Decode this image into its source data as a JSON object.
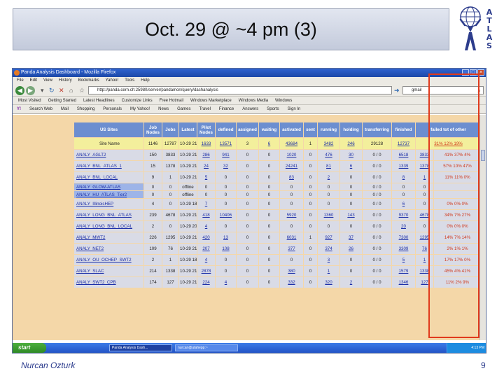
{
  "slide": {
    "title": "Oct. 29 @ ~4 pm (3)",
    "author": "Nurcan Ozturk",
    "page_number": "9",
    "logo_letters": [
      "A",
      "T",
      "L",
      "A",
      "S"
    ]
  },
  "browser": {
    "window_title": "Panda Analysis Dashboard - Mozilla Firefox",
    "menu": [
      "File",
      "Edit",
      "View",
      "History",
      "Bookmarks",
      "Yahoo!",
      "Tools",
      "Help"
    ],
    "url": "http://panda.cern.ch:25980/server/pandamon/query/dashanalysis",
    "search_value": "gmail",
    "bookmarks": [
      "Most Visited",
      "Getting Started",
      "Latest Headlines",
      "Customize Links",
      "Free Hotmail",
      "Windows Marketplace",
      "Windows Media",
      "Windows"
    ],
    "yahoo_toolbar": [
      "Search Web",
      "Mail",
      "Shopping",
      "Personals",
      "My Yahoo!",
      "News",
      "Games",
      "Travel",
      "Finance",
      "Answers",
      "Sports",
      "Sign In"
    ]
  },
  "table": {
    "headers": [
      "US Sites",
      "Job Nodes",
      "Jobs",
      "Latest",
      "Pilot Nodes",
      "defined",
      "assigned",
      "waiting",
      "activated",
      "sent",
      "running",
      "holding",
      "transferring",
      "finished",
      "failed tot of other"
    ],
    "summary": [
      "Site Name",
      "1146",
      "12787",
      "10-29 21:08",
      "1633",
      "13571",
      "3",
      "6",
      "43684",
      "1",
      "3482",
      "246",
      "29128",
      "12737",
      "31% 12% 19%"
    ],
    "rows": [
      [
        "ANALY_AGLT2",
        "150",
        "3833",
        "10-29 21:08",
        "286",
        "941",
        "0",
        "0",
        "1020",
        "0",
        "476",
        "30",
        "0 / 0",
        "6518",
        "3833",
        "41% 37% 4%"
      ],
      [
        "ANALY_BNL_ATLAS_1",
        "15",
        "1378",
        "10-29 21:08",
        "24",
        "32",
        "0",
        "0",
        "24241",
        "0",
        "81",
        "6",
        "0 / 0",
        "1339",
        "1378",
        "57% 10% 47%"
      ],
      [
        "ANALY_BNL_LOCAL",
        "9",
        "1",
        "10-29 21:07",
        "5",
        "0",
        "0",
        "0",
        "83",
        "0",
        "2",
        "0",
        "0 / 0",
        "8",
        "1",
        "11% 11% 0%"
      ],
      [
        "ANALY_GLOW-ATLAS",
        "0",
        "0",
        "offline",
        "0",
        "0",
        "0",
        "0",
        "0",
        "0",
        "0",
        "0",
        "0 / 0",
        "0",
        "0",
        ""
      ],
      [
        "ANALY_HU_ATLAS_Tier2",
        "0",
        "0",
        "offline",
        "0",
        "0",
        "0",
        "0",
        "0",
        "0",
        "0",
        "0",
        "0 / 0",
        "0",
        "0",
        ""
      ],
      [
        "ANALY_IllinoisHEP",
        "4",
        "0",
        "10-29 18:45",
        "7",
        "0",
        "0",
        "0",
        "0",
        "0",
        "0",
        "0",
        "0 / 0",
        "6",
        "0",
        "0% 0% 0%"
      ],
      [
        "ANALY_LONG_BNL_ATLAS",
        "239",
        "4678",
        "10-29 21:08",
        "418",
        "10406",
        "0",
        "0",
        "5920",
        "0",
        "1360",
        "143",
        "0 / 0",
        "9370",
        "4678",
        "34% 7% 27%"
      ],
      [
        "ANALY_LONG_BNL_LOCAL",
        "2",
        "0",
        "10-29 20:49",
        "4",
        "0",
        "0",
        "0",
        "0",
        "0",
        "0",
        "0",
        "0 / 0",
        "20",
        "0",
        "0% 0% 0%"
      ],
      [
        "ANALY_MWT2",
        "226",
        "1295",
        "10-29 21:08",
        "420",
        "13",
        "0",
        "0",
        "6031",
        "1",
        "927",
        "37",
        "0 / 0",
        "7300",
        "1295",
        "14% 7% 14%"
      ],
      [
        "ANALY_NET2",
        "109",
        "76",
        "10-29 21:08",
        "207",
        "108",
        "0",
        "0",
        "377",
        "0",
        "374",
        "26",
        "0 / 0",
        "3309",
        "76",
        "2% 1% 1%"
      ],
      [
        "ANALY_OU_OCHEP_SWT2",
        "2",
        "1",
        "10-29 18:53",
        "4",
        "0",
        "0",
        "0",
        "0",
        "0",
        "3",
        "0",
        "0 / 0",
        "5",
        "1",
        "17% 17% 0%"
      ],
      [
        "ANALY_SLAC",
        "214",
        "1338",
        "10-29 21:07",
        "2878",
        "0",
        "0",
        "0",
        "380",
        "0",
        "1",
        "0",
        "0 / 0",
        "1579",
        "1338",
        "45% 4% 41%"
      ],
      [
        "ANALY_SWT2_CPB",
        "174",
        "127",
        "10-29 21:08",
        "224",
        "4",
        "0",
        "0",
        "332",
        "0",
        "320",
        "2",
        "0 / 0",
        "1346",
        "127",
        "11% 2% 9%"
      ]
    ]
  },
  "taskbar": {
    "start": "start",
    "tasks": [
      "Panda Analysis Dash...",
      "nurcan@utahepp:~"
    ],
    "clock": "4:13 PM"
  },
  "colors": {
    "highlight_box": "#e03a1c",
    "header_bg": "#6c8ed0",
    "page_bg": "#f4d7a8"
  }
}
